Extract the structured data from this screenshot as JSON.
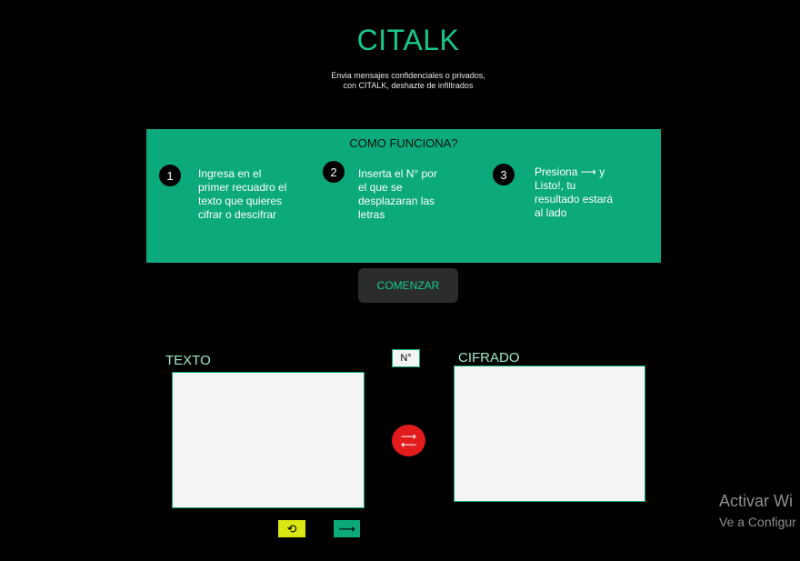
{
  "header": {
    "title": "CITALK",
    "subtitle_line1": "Envia mensajes confidenciales o privados,",
    "subtitle_line2": "con CITALK, deshazte de infiltrados"
  },
  "how_it_works": {
    "title": "COMO FUNCIONA?",
    "steps": [
      {
        "number": "1",
        "text": "Ingresa en el\nprimer recuadro el\ntexto que quieres\ncifrar o descifrar"
      },
      {
        "number": "2",
        "text": "Inserta el N° por\nel que se\ndesplazaran las\nletras"
      },
      {
        "number": "3",
        "text": "Presiona ⟶ y\nListo!, tu\nresultado estará\nal lado"
      }
    ]
  },
  "start_button": {
    "label": "COMENZAR"
  },
  "input_section": {
    "label": "TEXTO",
    "value": ""
  },
  "shift": {
    "placeholder": "N°",
    "value": ""
  },
  "output_section": {
    "label": "CIFRADO",
    "value": ""
  },
  "controls": {
    "swap_icon": "swap-arrows-icon",
    "reset_icon": "refresh-icon",
    "go_icon": "arrow-right-icon"
  },
  "colors": {
    "accent": "#17c98a",
    "panel": "#0caa7a",
    "swap": "#e21c1c",
    "reset": "#d9e612"
  },
  "os_watermark": {
    "title": "Activar Wi",
    "subtitle": "Ve a Configur"
  }
}
